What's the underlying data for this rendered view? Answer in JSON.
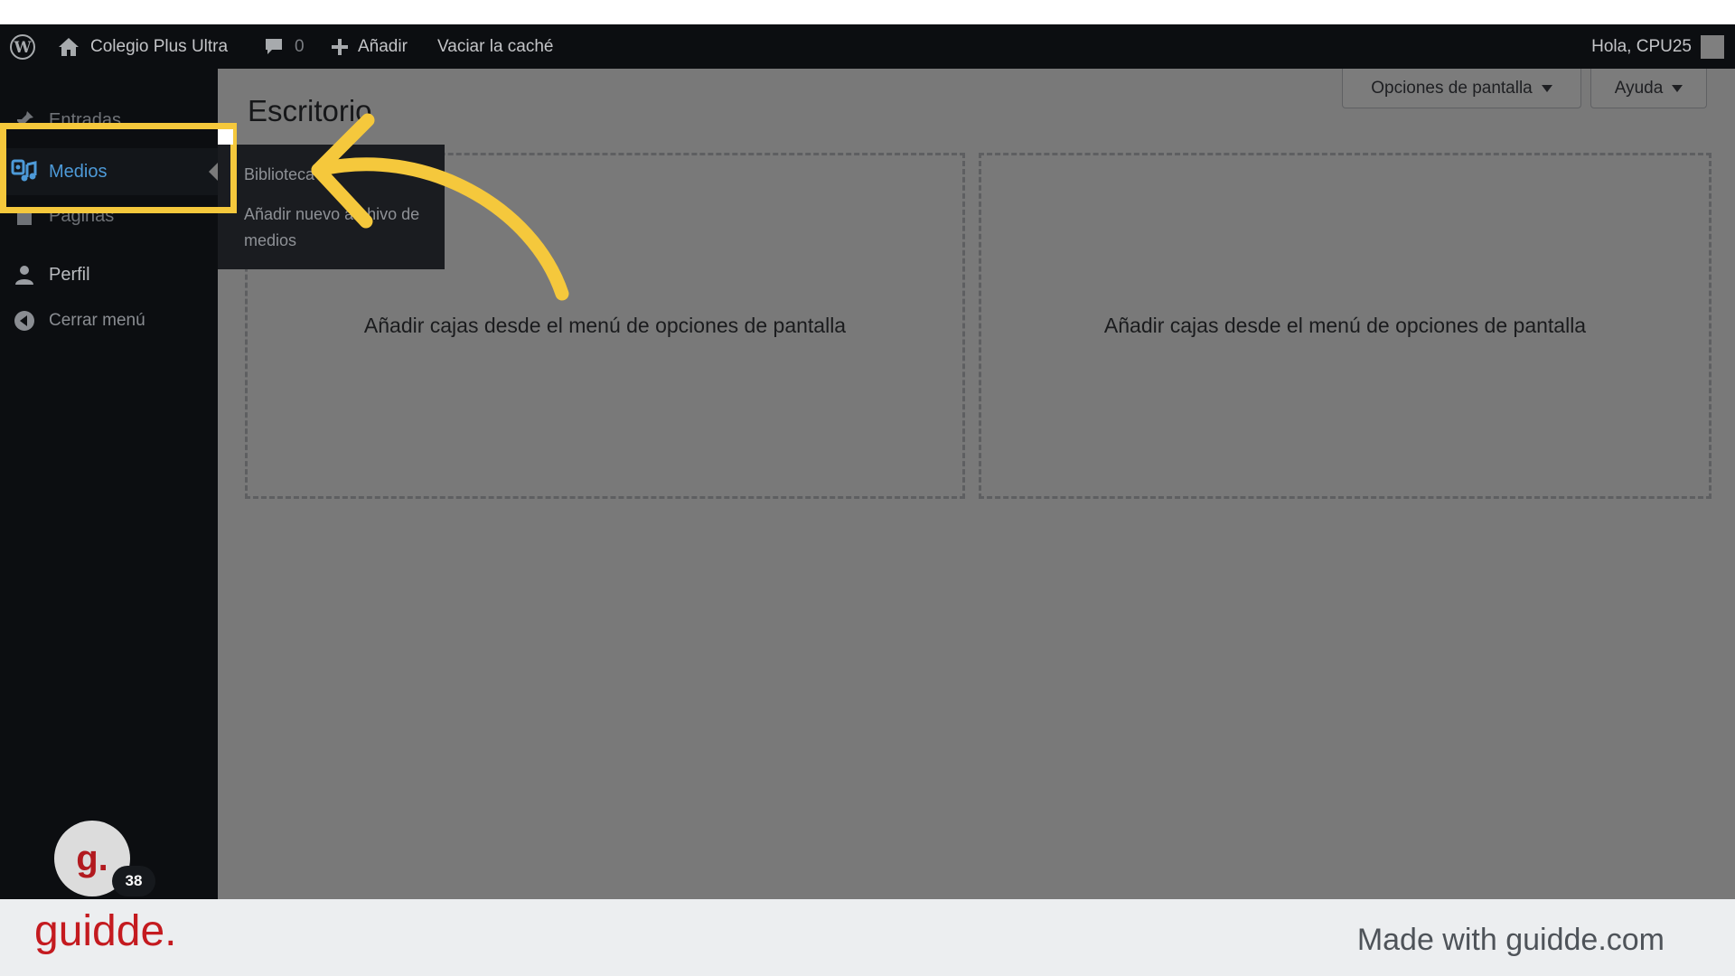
{
  "admin_bar": {
    "site_name": "Colegio Plus Ultra",
    "comments_count": "0",
    "new_label": "Añadir",
    "cache_label": "Vaciar la caché",
    "greeting": "Hola, CPU25"
  },
  "sidebar": {
    "items": [
      {
        "label": "Entradas",
        "icon": "pin-icon"
      },
      {
        "label": "Medios",
        "icon": "media-icon",
        "active": true
      },
      {
        "label": "Páginas",
        "icon": "page-icon"
      },
      {
        "label": "Perfil",
        "icon": "user-icon"
      },
      {
        "label": "Cerrar menú",
        "icon": "collapse-icon"
      }
    ]
  },
  "flyout": {
    "items": [
      "Biblioteca",
      "Añadir nuevo archivo de medios"
    ]
  },
  "main": {
    "title": "Escritorio",
    "screen_options_label": "Opciones de pantalla",
    "help_label": "Ayuda",
    "dropzones": [
      "Añadir cajas desde el menú de opciones de pantalla",
      "Añadir cajas desde el menú de opciones de pantalla"
    ]
  },
  "guidde": {
    "bubble_letter": "g.",
    "step_count": "38",
    "brand": "guidde.",
    "made_with": "Made with guidde.com"
  },
  "colors": {
    "highlight": "#f5c83c",
    "admin_bg": "#0c0e11",
    "content_overlay": "#797979",
    "active_menu": "#4d9ad8",
    "brand_red": "#c41a1f"
  }
}
